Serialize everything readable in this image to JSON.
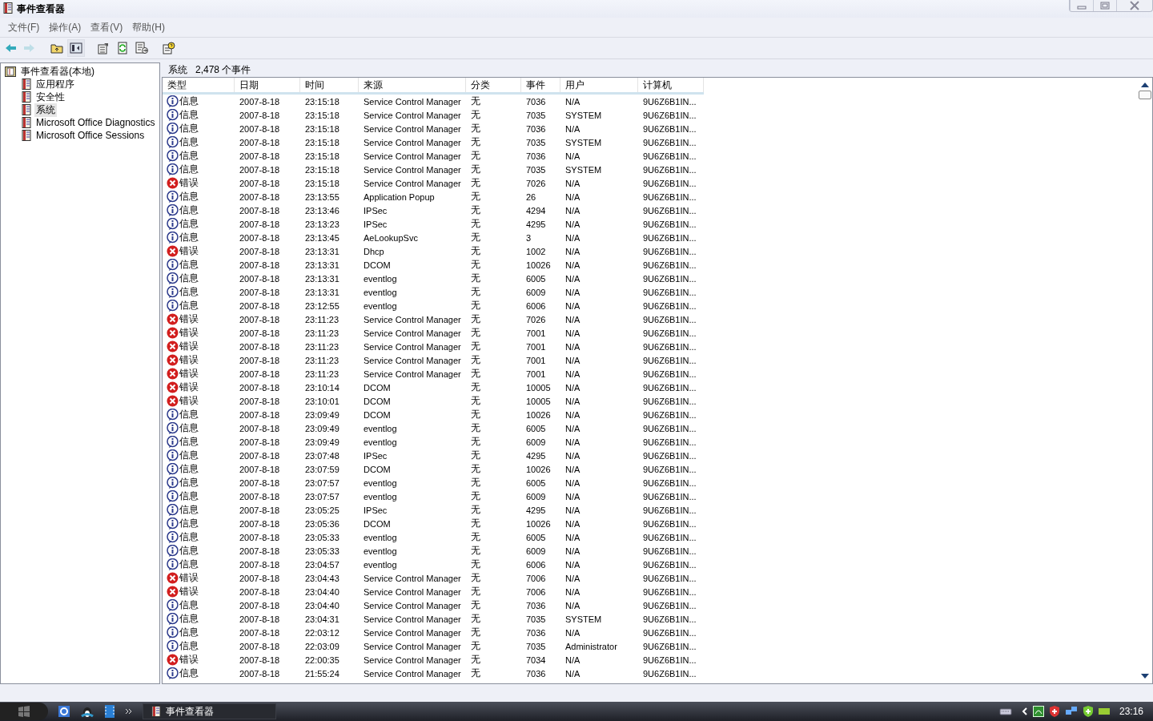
{
  "window": {
    "title": "事件查看器"
  },
  "menu": [
    "文件(F)",
    "操作(A)",
    "查看(V)",
    "帮助(H)"
  ],
  "toolbar": [
    {
      "kind": "back",
      "disabled": false
    },
    {
      "kind": "forward",
      "disabled": true
    },
    {
      "kind": "up",
      "disabled": false
    },
    {
      "kind": "tree",
      "disabled": false
    },
    {
      "kind": "props",
      "disabled": false
    },
    {
      "kind": "refresh",
      "disabled": false
    },
    {
      "kind": "export",
      "disabled": false
    },
    {
      "kind": "help",
      "disabled": false
    }
  ],
  "tree": {
    "label": "事件查看器(本地)",
    "children": [
      {
        "label": "应用程序",
        "selected": false
      },
      {
        "label": "安全性",
        "selected": false
      },
      {
        "label": "系统",
        "selected": true
      },
      {
        "label": "Microsoft Office Diagnostics",
        "selected": false
      },
      {
        "label": "Microsoft Office Sessions",
        "selected": false
      }
    ]
  },
  "pane_header": {
    "title": "系统",
    "count": "2,478 个事件"
  },
  "table": {
    "columns": [
      "类型",
      "日期",
      "时间",
      "来源",
      "分类",
      "事件",
      "用户",
      "计算机"
    ],
    "rows": [
      {
        "kind": "info",
        "cells": [
          "信息",
          "2007-8-18",
          "23:15:18",
          "Service Control Manager",
          "无",
          "7036",
          "N/A",
          "9U6Z6B1IN..."
        ]
      },
      {
        "kind": "info",
        "cells": [
          "信息",
          "2007-8-18",
          "23:15:18",
          "Service Control Manager",
          "无",
          "7035",
          "SYSTEM",
          "9U6Z6B1IN..."
        ]
      },
      {
        "kind": "info",
        "cells": [
          "信息",
          "2007-8-18",
          "23:15:18",
          "Service Control Manager",
          "无",
          "7036",
          "N/A",
          "9U6Z6B1IN..."
        ]
      },
      {
        "kind": "info",
        "cells": [
          "信息",
          "2007-8-18",
          "23:15:18",
          "Service Control Manager",
          "无",
          "7035",
          "SYSTEM",
          "9U6Z6B1IN..."
        ]
      },
      {
        "kind": "info",
        "cells": [
          "信息",
          "2007-8-18",
          "23:15:18",
          "Service Control Manager",
          "无",
          "7036",
          "N/A",
          "9U6Z6B1IN..."
        ]
      },
      {
        "kind": "info",
        "cells": [
          "信息",
          "2007-8-18",
          "23:15:18",
          "Service Control Manager",
          "无",
          "7035",
          "SYSTEM",
          "9U6Z6B1IN..."
        ]
      },
      {
        "kind": "error",
        "cells": [
          "错误",
          "2007-8-18",
          "23:15:18",
          "Service Control Manager",
          "无",
          "7026",
          "N/A",
          "9U6Z6B1IN..."
        ]
      },
      {
        "kind": "info",
        "cells": [
          "信息",
          "2007-8-18",
          "23:13:55",
          "Application Popup",
          "无",
          "26",
          "N/A",
          "9U6Z6B1IN..."
        ]
      },
      {
        "kind": "info",
        "cells": [
          "信息",
          "2007-8-18",
          "23:13:46",
          "IPSec",
          "无",
          "4294",
          "N/A",
          "9U6Z6B1IN..."
        ]
      },
      {
        "kind": "info",
        "cells": [
          "信息",
          "2007-8-18",
          "23:13:23",
          "IPSec",
          "无",
          "4295",
          "N/A",
          "9U6Z6B1IN..."
        ]
      },
      {
        "kind": "info",
        "cells": [
          "信息",
          "2007-8-18",
          "23:13:45",
          "AeLookupSvc",
          "无",
          "3",
          "N/A",
          "9U6Z6B1IN..."
        ]
      },
      {
        "kind": "error",
        "cells": [
          "错误",
          "2007-8-18",
          "23:13:31",
          "Dhcp",
          "无",
          "1002",
          "N/A",
          "9U6Z6B1IN..."
        ]
      },
      {
        "kind": "info",
        "cells": [
          "信息",
          "2007-8-18",
          "23:13:31",
          "DCOM",
          "无",
          "10026",
          "N/A",
          "9U6Z6B1IN..."
        ]
      },
      {
        "kind": "info",
        "cells": [
          "信息",
          "2007-8-18",
          "23:13:31",
          "eventlog",
          "无",
          "6005",
          "N/A",
          "9U6Z6B1IN..."
        ]
      },
      {
        "kind": "info",
        "cells": [
          "信息",
          "2007-8-18",
          "23:13:31",
          "eventlog",
          "无",
          "6009",
          "N/A",
          "9U6Z6B1IN..."
        ]
      },
      {
        "kind": "info",
        "cells": [
          "信息",
          "2007-8-18",
          "23:12:55",
          "eventlog",
          "无",
          "6006",
          "N/A",
          "9U6Z6B1IN..."
        ]
      },
      {
        "kind": "error",
        "cells": [
          "错误",
          "2007-8-18",
          "23:11:23",
          "Service Control Manager",
          "无",
          "7026",
          "N/A",
          "9U6Z6B1IN..."
        ]
      },
      {
        "kind": "error",
        "cells": [
          "错误",
          "2007-8-18",
          "23:11:23",
          "Service Control Manager",
          "无",
          "7001",
          "N/A",
          "9U6Z6B1IN..."
        ]
      },
      {
        "kind": "error",
        "cells": [
          "错误",
          "2007-8-18",
          "23:11:23",
          "Service Control Manager",
          "无",
          "7001",
          "N/A",
          "9U6Z6B1IN..."
        ]
      },
      {
        "kind": "error",
        "cells": [
          "错误",
          "2007-8-18",
          "23:11:23",
          "Service Control Manager",
          "无",
          "7001",
          "N/A",
          "9U6Z6B1IN..."
        ]
      },
      {
        "kind": "error",
        "cells": [
          "错误",
          "2007-8-18",
          "23:11:23",
          "Service Control Manager",
          "无",
          "7001",
          "N/A",
          "9U6Z6B1IN..."
        ]
      },
      {
        "kind": "error",
        "cells": [
          "错误",
          "2007-8-18",
          "23:10:14",
          "DCOM",
          "无",
          "10005",
          "N/A",
          "9U6Z6B1IN..."
        ]
      },
      {
        "kind": "error",
        "cells": [
          "错误",
          "2007-8-18",
          "23:10:01",
          "DCOM",
          "无",
          "10005",
          "N/A",
          "9U6Z6B1IN..."
        ]
      },
      {
        "kind": "info",
        "cells": [
          "信息",
          "2007-8-18",
          "23:09:49",
          "DCOM",
          "无",
          "10026",
          "N/A",
          "9U6Z6B1IN..."
        ]
      },
      {
        "kind": "info",
        "cells": [
          "信息",
          "2007-8-18",
          "23:09:49",
          "eventlog",
          "无",
          "6005",
          "N/A",
          "9U6Z6B1IN..."
        ]
      },
      {
        "kind": "info",
        "cells": [
          "信息",
          "2007-8-18",
          "23:09:49",
          "eventlog",
          "无",
          "6009",
          "N/A",
          "9U6Z6B1IN..."
        ]
      },
      {
        "kind": "info",
        "cells": [
          "信息",
          "2007-8-18",
          "23:07:48",
          "IPSec",
          "无",
          "4295",
          "N/A",
          "9U6Z6B1IN..."
        ]
      },
      {
        "kind": "info",
        "cells": [
          "信息",
          "2007-8-18",
          "23:07:59",
          "DCOM",
          "无",
          "10026",
          "N/A",
          "9U6Z6B1IN..."
        ]
      },
      {
        "kind": "info",
        "cells": [
          "信息",
          "2007-8-18",
          "23:07:57",
          "eventlog",
          "无",
          "6005",
          "N/A",
          "9U6Z6B1IN..."
        ]
      },
      {
        "kind": "info",
        "cells": [
          "信息",
          "2007-8-18",
          "23:07:57",
          "eventlog",
          "无",
          "6009",
          "N/A",
          "9U6Z6B1IN..."
        ]
      },
      {
        "kind": "info",
        "cells": [
          "信息",
          "2007-8-18",
          "23:05:25",
          "IPSec",
          "无",
          "4295",
          "N/A",
          "9U6Z6B1IN..."
        ]
      },
      {
        "kind": "info",
        "cells": [
          "信息",
          "2007-8-18",
          "23:05:36",
          "DCOM",
          "无",
          "10026",
          "N/A",
          "9U6Z6B1IN..."
        ]
      },
      {
        "kind": "info",
        "cells": [
          "信息",
          "2007-8-18",
          "23:05:33",
          "eventlog",
          "无",
          "6005",
          "N/A",
          "9U6Z6B1IN..."
        ]
      },
      {
        "kind": "info",
        "cells": [
          "信息",
          "2007-8-18",
          "23:05:33",
          "eventlog",
          "无",
          "6009",
          "N/A",
          "9U6Z6B1IN..."
        ]
      },
      {
        "kind": "info",
        "cells": [
          "信息",
          "2007-8-18",
          "23:04:57",
          "eventlog",
          "无",
          "6006",
          "N/A",
          "9U6Z6B1IN..."
        ]
      },
      {
        "kind": "error",
        "cells": [
          "错误",
          "2007-8-18",
          "23:04:43",
          "Service Control Manager",
          "无",
          "7006",
          "N/A",
          "9U6Z6B1IN..."
        ]
      },
      {
        "kind": "error",
        "cells": [
          "错误",
          "2007-8-18",
          "23:04:40",
          "Service Control Manager",
          "无",
          "7006",
          "N/A",
          "9U6Z6B1IN..."
        ]
      },
      {
        "kind": "info",
        "cells": [
          "信息",
          "2007-8-18",
          "23:04:40",
          "Service Control Manager",
          "无",
          "7036",
          "N/A",
          "9U6Z6B1IN..."
        ]
      },
      {
        "kind": "info",
        "cells": [
          "信息",
          "2007-8-18",
          "23:04:31",
          "Service Control Manager",
          "无",
          "7035",
          "SYSTEM",
          "9U6Z6B1IN..."
        ]
      },
      {
        "kind": "info",
        "cells": [
          "信息",
          "2007-8-18",
          "22:03:12",
          "Service Control Manager",
          "无",
          "7036",
          "N/A",
          "9U6Z6B1IN..."
        ]
      },
      {
        "kind": "info",
        "cells": [
          "信息",
          "2007-8-18",
          "22:03:09",
          "Service Control Manager",
          "无",
          "7035",
          "Administrator",
          "9U6Z6B1IN..."
        ]
      },
      {
        "kind": "error",
        "cells": [
          "错误",
          "2007-8-18",
          "22:00:35",
          "Service Control Manager",
          "无",
          "7034",
          "N/A",
          "9U6Z6B1IN..."
        ]
      },
      {
        "kind": "info",
        "cells": [
          "信息",
          "2007-8-18",
          "21:55:24",
          "Service Control Manager",
          "无",
          "7036",
          "N/A",
          "9U6Z6B1IN..."
        ]
      }
    ]
  },
  "taskbar": {
    "task": "事件查看器",
    "clock": "23:16"
  }
}
